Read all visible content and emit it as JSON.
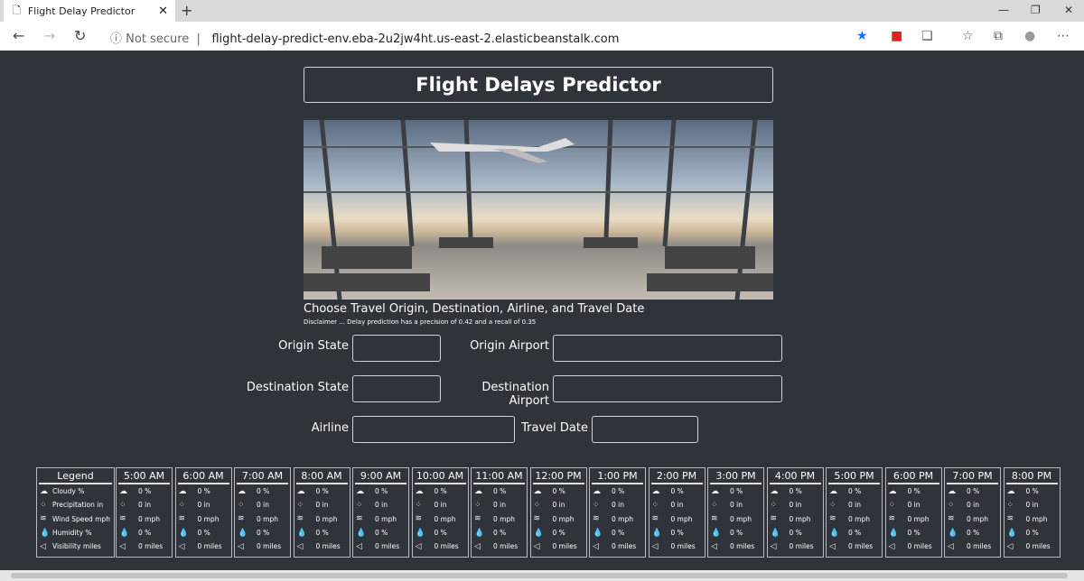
{
  "browser": {
    "tab_title": "Flight Delay Predictor",
    "not_secure": "Not secure",
    "url": "flight-delay-predict-env.eba-2u2jw4ht.us-east-2.elasticbeanstalk.com"
  },
  "header": {
    "title": "Flight Delays Predictor"
  },
  "intro": {
    "heading": "Choose Travel Origin, Destination, Airline, and Travel Date",
    "disclaimer": "Disclaimer ... Delay prediction has a precision of 0.42 and a recall of 0.35"
  },
  "form": {
    "origin_state": "Origin State",
    "origin_airport": "Origin Airport",
    "destination_state": "Destination State",
    "destination_airport": "Destination Airport",
    "airline": "Airline",
    "travel_date": "Travel Date"
  },
  "legend": {
    "title": "Legend",
    "items": [
      "Cloudy %",
      "Precipitation in",
      "Wind Speed mph",
      "Humidity %",
      "Visibility miles"
    ]
  },
  "hours": [
    {
      "time": "5:00 AM"
    },
    {
      "time": "6:00 AM"
    },
    {
      "time": "7:00 AM"
    },
    {
      "time": "8:00 AM"
    },
    {
      "time": "9:00 AM"
    },
    {
      "time": "10:00 AM"
    },
    {
      "time": "11:00 AM"
    },
    {
      "time": "12:00 PM"
    },
    {
      "time": "1:00 PM"
    },
    {
      "time": "2:00 PM"
    },
    {
      "time": "3:00 PM"
    },
    {
      "time": "4:00 PM"
    },
    {
      "time": "5:00 PM"
    },
    {
      "time": "6:00 PM"
    },
    {
      "time": "7:00 PM"
    },
    {
      "time": "8:00 PM"
    }
  ],
  "hour_values": [
    "0 %",
    "0 in",
    "0 mph",
    "0 %",
    "0 miles"
  ]
}
